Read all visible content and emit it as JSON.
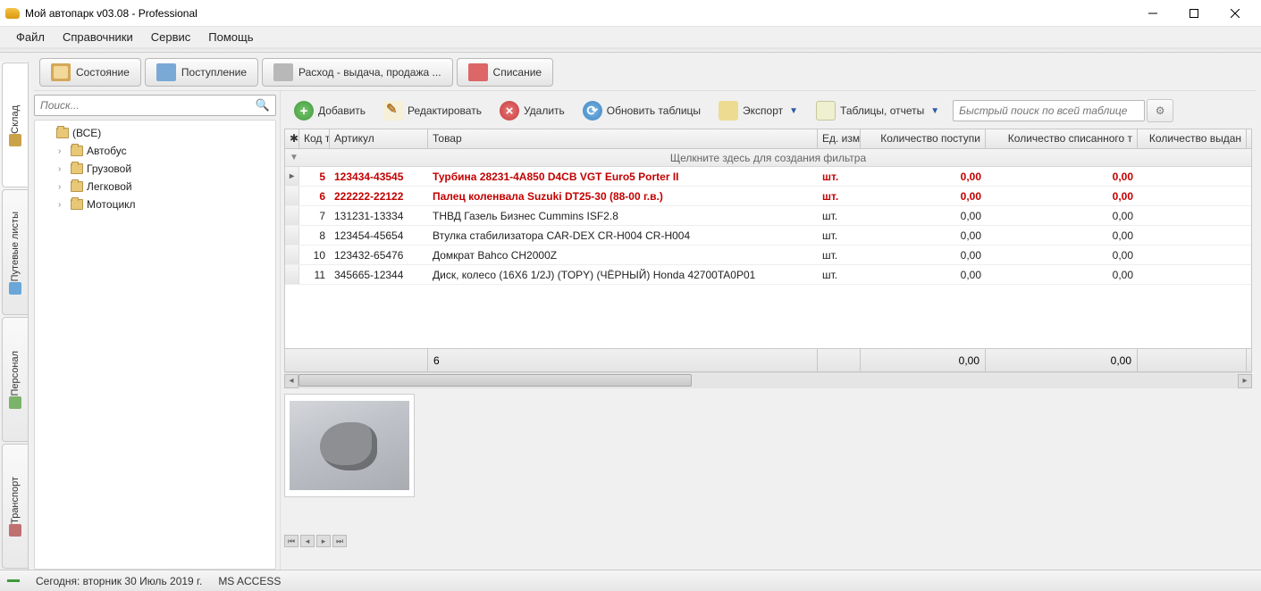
{
  "window": {
    "title": "Мой автопарк v03.08 - Professional"
  },
  "menu": {
    "file": "Файл",
    "refs": "Справочники",
    "service": "Сервис",
    "help": "Помощь"
  },
  "sideTabs": {
    "stock": "Склад",
    "waybills": "Путевые листы",
    "personnel": "Персонал",
    "transport": "Транспорт"
  },
  "topTabs": {
    "state": "Состояние",
    "income": "Поступление",
    "outcome": "Расход - выдача, продажа ...",
    "writeoff": "Списание"
  },
  "tree": {
    "searchPlaceholder": "Поиск...",
    "root": "(ВСЕ)",
    "items": [
      "Автобус",
      "Грузовой",
      "Легковой",
      "Мотоцикл"
    ]
  },
  "toolbar": {
    "add": "Добавить",
    "edit": "Редактировать",
    "delete": "Удалить",
    "refresh": "Обновить таблицы",
    "export": "Экспорт",
    "reports": "Таблицы, отчеты",
    "quickSearch": "Быстрый поиск по всей таблице"
  },
  "grid": {
    "headers": {
      "code": "Код т",
      "article": "Артикул",
      "name": "Товар",
      "unit": "Ед. изм.",
      "qtyIn": "Количество поступи",
      "qtyOff": "Количество списанного т",
      "qtyOut": "Количество выдан"
    },
    "filterHint": "Щелкните здесь для создания фильтра",
    "rows": [
      {
        "code": "5",
        "article": "123434-43545",
        "name": "Турбина 28231-4A850 D4CB VGT Euro5 Porter II",
        "unit": "шт.",
        "q1": "0,00",
        "q2": "0,00",
        "red": true,
        "selected": true
      },
      {
        "code": "6",
        "article": "222222-22122",
        "name": "Палец коленвала Suzuki DT25-30 (88-00 г.в.)",
        "unit": "шт.",
        "q1": "0,00",
        "q2": "0,00",
        "red": true
      },
      {
        "code": "7",
        "article": "131231-13334",
        "name": "ТНВД Газель Бизнес Cummins ISF2.8",
        "unit": "шт.",
        "q1": "0,00",
        "q2": "0,00"
      },
      {
        "code": "8",
        "article": "123454-45654",
        "name": "Втулка стабилизатора CAR-DEX CR-H004 CR-H004",
        "unit": "шт.",
        "q1": "0,00",
        "q2": "0,00"
      },
      {
        "code": "10",
        "article": "123432-65476",
        "name": "Домкрат Bahco CH2000Z",
        "unit": "шт.",
        "q1": "0,00",
        "q2": "0,00"
      },
      {
        "code": "11",
        "article": "345665-12344",
        "name": "Диск, колесо (16X6 1/2J) (TOPY) (ЧЁРНЫЙ) Honda 42700TA0P01",
        "unit": "шт.",
        "q1": "0,00",
        "q2": "0,00"
      }
    ],
    "footer": {
      "count": "6",
      "sum1": "0,00",
      "sum2": "0,00"
    }
  },
  "status": {
    "today": "Сегодня: вторник 30 Июль 2019 г.",
    "db": "MS ACCESS"
  }
}
